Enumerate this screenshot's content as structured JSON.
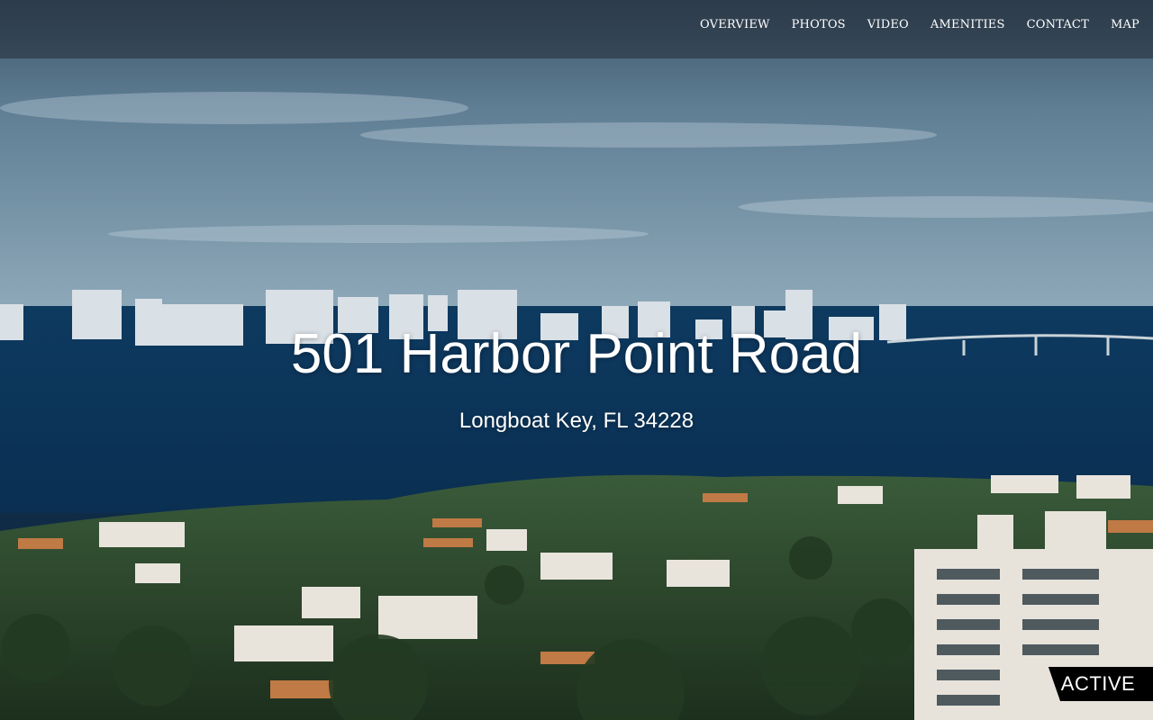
{
  "nav": {
    "items": [
      {
        "label": "OVERVIEW"
      },
      {
        "label": "PHOTOS"
      },
      {
        "label": "VIDEO"
      },
      {
        "label": "AMENITIES"
      },
      {
        "label": "CONTACT"
      },
      {
        "label": "MAP"
      }
    ]
  },
  "hero": {
    "title": "501 Harbor Point Road",
    "subtitle": "Longboat Key, FL 34228"
  },
  "status": {
    "label": "ACTIVE"
  },
  "colors": {
    "sky": "#5f7f95",
    "water": "#0d3c62",
    "foliage": "#2f4a2a",
    "nav_bar": "#2d3c4b",
    "badge": "#000000"
  }
}
